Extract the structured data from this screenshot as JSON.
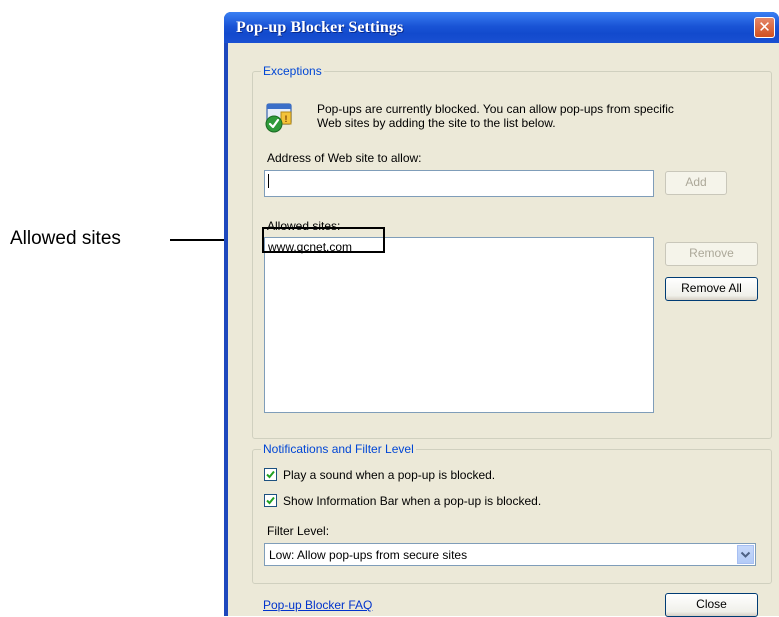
{
  "annotation": {
    "label": "Allowed sites"
  },
  "window": {
    "title": "Pop-up Blocker Settings",
    "close_glyph": "✕"
  },
  "exceptions": {
    "legend": "Exceptions",
    "info_line1": "Pop-ups are currently blocked.  You can allow pop-ups from specific",
    "info_line2": "Web sites by adding the site to the list below.",
    "address_label": "Address of Web site to allow:",
    "address_value": "",
    "add_label": "Add",
    "allowed_label": "Allowed sites:",
    "allowed_sites": [
      "www.qcnet.com"
    ],
    "remove_label": "Remove",
    "remove_all_label": "Remove All"
  },
  "notifications": {
    "legend": "Notifications and Filter Level",
    "play_sound_label": "Play a sound when a pop-up is blocked.",
    "play_sound_checked": true,
    "show_info_bar_label": "Show Information Bar when a pop-up is blocked.",
    "show_info_bar_checked": true,
    "filter_level_label": "Filter Level:",
    "filter_level_value": "Low: Allow pop-ups from secure sites"
  },
  "footer": {
    "faq_link": "Pop-up Blocker FAQ",
    "close_label": "Close"
  },
  "icons": {
    "info": "popup-blocker-shield-icon",
    "close": "close-icon",
    "dropdown": "chevron-down-icon",
    "check": "check-icon"
  },
  "colors": {
    "titlebar": "#1a54d6",
    "client": "#ece9d8",
    "group_legend": "#0046d5",
    "link": "#0033cc",
    "close_button": "#d2501f"
  }
}
